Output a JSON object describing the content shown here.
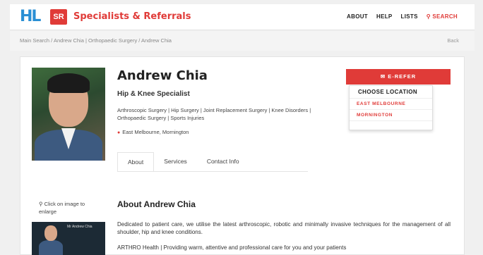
{
  "header": {
    "logo_hl": "HL",
    "logo_sr": "SR",
    "brand": "Specialists & Referrals",
    "nav": [
      "ABOUT",
      "HELP",
      "LISTS"
    ],
    "search_label": "SEARCH"
  },
  "breadcrumb": "Main Search / Andrew Chia | Orthopaedic Surgery / Andrew Chia",
  "back_label": "Back",
  "profile": {
    "name": "Andrew Chia",
    "title": "Hip & Knee Specialist",
    "specialties": "Arthroscopic Surgery | Hip Surgery | Joint Replacement Surgery | Knee Disorders | Orthopaedic Surgery | Sports Injuries",
    "locations": "East Melbourne, Mornington"
  },
  "tabs": [
    "About",
    "Services",
    "Contact Info"
  ],
  "refer": {
    "button_label": "E-REFER",
    "dropdown_header": "CHOOSE LOCATION",
    "options": [
      "EAST MELBOURNE",
      "MORNINGTON"
    ]
  },
  "zoom_hint": "Click on image to enlarge",
  "thumb_caption": "Mr Andrew Chia",
  "about": {
    "heading": "About Andrew Chia",
    "paragraph": "Dedicated to patient care, we utilise the latest arthroscopic, robotic and minimally invasive techniques for the management of all shoulder, hip and knee conditions.",
    "tagline": "ARTHRO Health | Providing warm, attentive and professional care for you and your patients"
  },
  "colors": {
    "accent": "#e03b38",
    "logo_blue": "#2a8fd4"
  }
}
